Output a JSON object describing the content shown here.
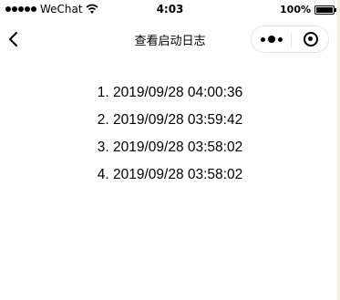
{
  "status_bar": {
    "carrier": "WeChat",
    "time": "4:03",
    "battery_percent": "100%",
    "battery_level": 1.0,
    "signal_bars_filled": 5
  },
  "nav": {
    "title": "查看启动日志",
    "back_icon": "chevron-left-icon",
    "menu_icon": "more-dots-icon",
    "close_icon": "target-close-icon"
  },
  "logs": [
    {
      "label": "1. 2019/09/28 04:00:36"
    },
    {
      "label": "2. 2019/09/28 03:59:42"
    },
    {
      "label": "3. 2019/09/28 03:58:02"
    },
    {
      "label": "4. 2019/09/28 03:58:02"
    }
  ]
}
